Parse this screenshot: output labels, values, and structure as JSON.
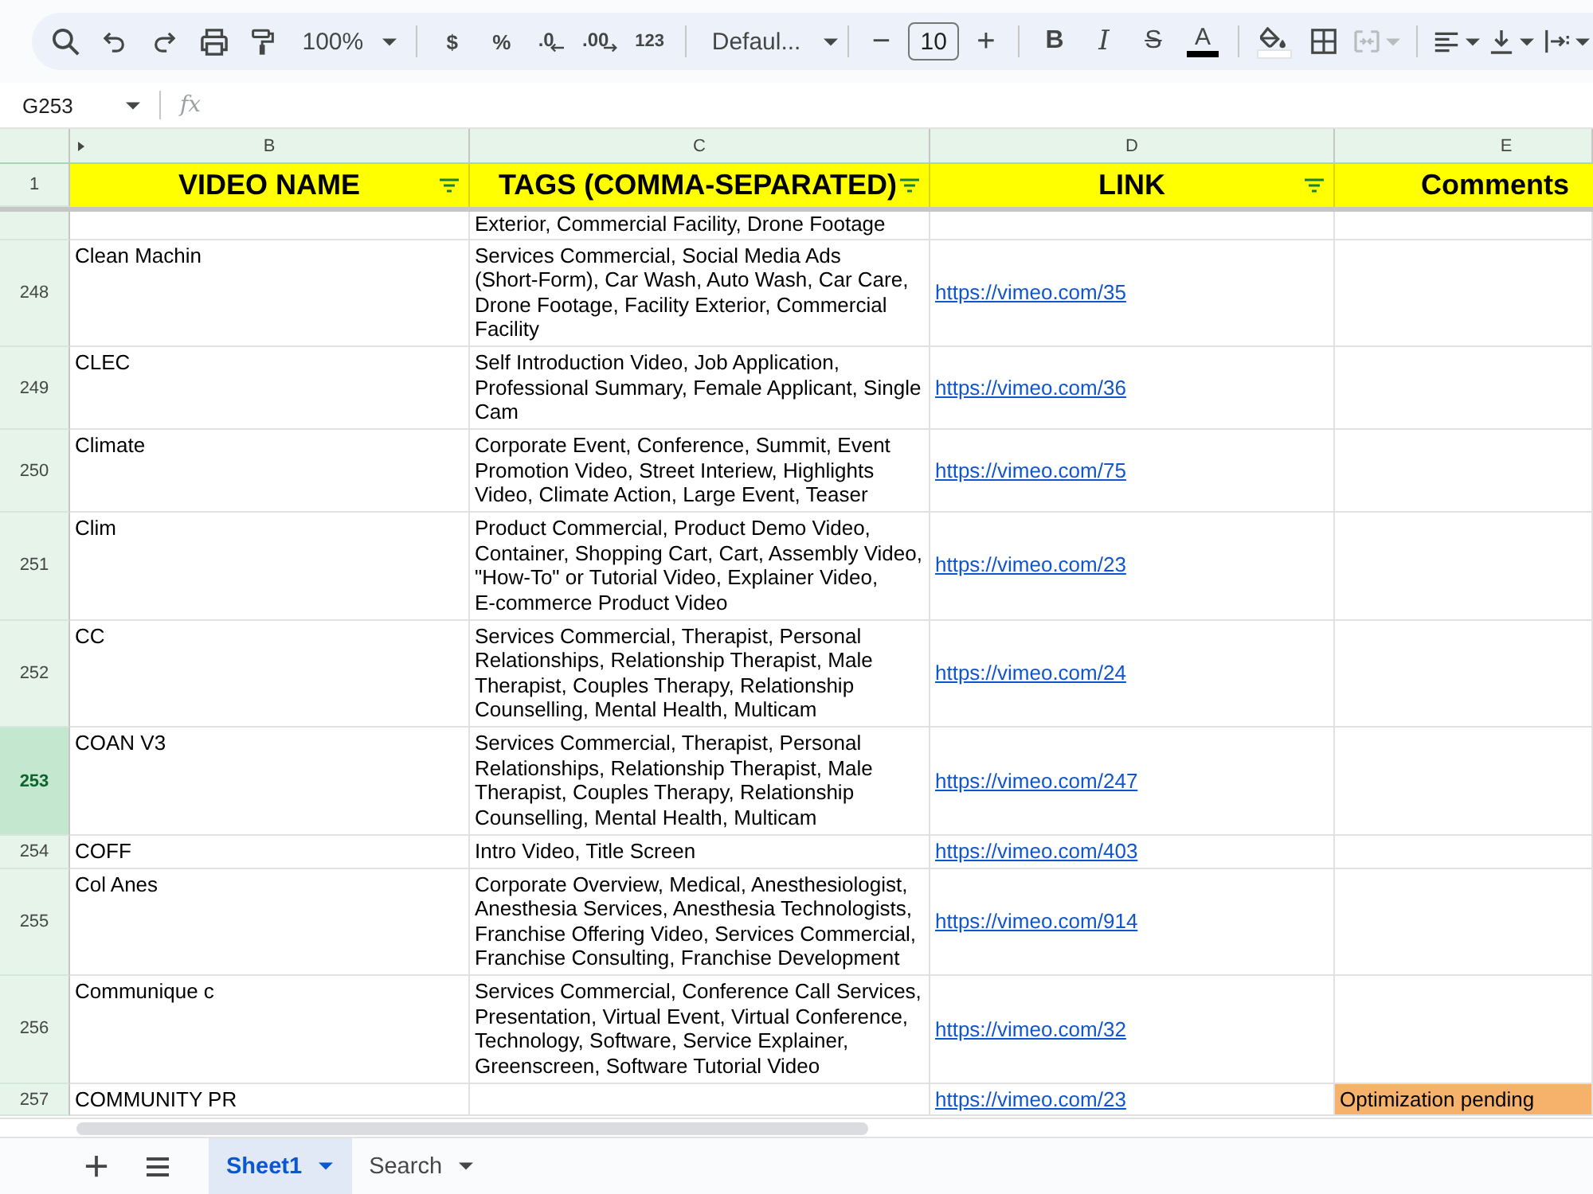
{
  "toolbar": {
    "groups": [
      [
        {
          "kind": "search"
        },
        {
          "kind": "undo"
        },
        {
          "kind": "redo"
        },
        {
          "kind": "print"
        },
        {
          "kind": "paint_format"
        },
        {
          "kind": "zoom",
          "label": "100%",
          "menu": true
        }
      ],
      [
        {
          "kind": "currency",
          "label": "$"
        },
        {
          "kind": "percent",
          "label": "%"
        },
        {
          "kind": "decimal_down",
          "label": ".0"
        },
        {
          "kind": "decimal_up",
          "label": ".00"
        },
        {
          "kind": "number_format",
          "label": "123"
        }
      ],
      [
        {
          "kind": "font",
          "label": "Defaul...",
          "menu": true
        }
      ],
      [
        {
          "kind": "size_down",
          "label": "−"
        },
        {
          "kind": "font_size",
          "value": "10"
        },
        {
          "kind": "size_up",
          "label": "+"
        }
      ],
      [
        {
          "kind": "bold",
          "label": "B"
        },
        {
          "kind": "italic",
          "label": "I"
        },
        {
          "kind": "strike",
          "label": "S"
        },
        {
          "kind": "text_color",
          "label": "A"
        }
      ],
      [
        {
          "kind": "fill_color"
        },
        {
          "kind": "borders"
        },
        {
          "kind": "merge",
          "menu": true,
          "disabled": true
        }
      ],
      [
        {
          "kind": "align",
          "menu": true
        },
        {
          "kind": "valign",
          "menu": true
        },
        {
          "kind": "wrap",
          "menu": true
        }
      ]
    ]
  },
  "formula_bar": {
    "cell_ref": "G253",
    "fx": "fx"
  },
  "sheet": {
    "columns": [
      {
        "letter": "B"
      },
      {
        "letter": "C"
      },
      {
        "letter": "D"
      },
      {
        "letter": "E"
      }
    ],
    "header_row": {
      "number": "1",
      "cells": [
        {
          "label": "VIDEO NAME",
          "filter": true
        },
        {
          "label": "TAGS (COMMA-SEPARATED)",
          "filter": true
        },
        {
          "label": "LINK",
          "filter": true
        },
        {
          "label": "Comments",
          "filter": false
        }
      ]
    },
    "rows": [
      {
        "selected": false,
        "tags": "Exterior, Commercial Facility, Drone Footage"
      },
      {
        "number": "248",
        "selected": false,
        "video_name": "Clean Machin",
        "tags": "Services Commercial, Social Media Ads (Short-Form), Car Wash, Auto Wash, Car Care, Drone Footage, Facility Exterior, Commercial Facility",
        "link": "https://vimeo.com/35"
      },
      {
        "number": "249",
        "selected": false,
        "video_name": "CLEC",
        "tags": "Self Introduction Video, Job Application, Professional Summary, Female Applicant, Single Cam",
        "link": "https://vimeo.com/36"
      },
      {
        "number": "250",
        "selected": false,
        "video_name": "Climate",
        "tags": "Corporate Event, Conference, Summit, Event Promotion Video, Street Interiew, Highlights Video, Climate Action, Large Event, Teaser",
        "link": "https://vimeo.com/75"
      },
      {
        "number": "251",
        "selected": false,
        "video_name": "Clim",
        "tags": "Product Commercial, Product Demo Video, Container, Shopping Cart, Cart, Assembly Video, \"How-To\" or Tutorial Video, Explainer Video, E-commerce Product Video",
        "link": "https://vimeo.com/23"
      },
      {
        "number": "252",
        "selected": false,
        "video_name": "CC",
        "tags": "Services Commercial, Therapist, Personal Relationships, Relationship Therapist, Male Therapist, Couples Therapy, Relationship Counselling, Mental Health, Multicam",
        "link": "https://vimeo.com/24"
      },
      {
        "number": "253",
        "selected": true,
        "video_name": "COAN V3",
        "tags": "Services Commercial, Therapist, Personal Relationships, Relationship Therapist, Male Therapist, Couples Therapy, Relationship Counselling, Mental Health, Multicam",
        "link": "https://vimeo.com/247"
      },
      {
        "number": "254",
        "selected": false,
        "video_name": "COFF",
        "tags": "Intro Video, Title Screen",
        "link": "https://vimeo.com/403"
      },
      {
        "number": "255",
        "selected": false,
        "video_name": "Col Anes",
        "tags": "Corporate Overview, Medical, Anesthesiologist, Anesthesia Services, Anesthesia Technologists, Franchise Offering Video, Services Commercial, Franchise Consulting, Franchise Development",
        "link": "https://vimeo.com/914"
      },
      {
        "number": "256",
        "selected": false,
        "video_name": "Communique c",
        "tags": "Services Commercial, Conference Call Services, Presentation, Virtual Event, Virtual Conference, Technology, Software, Service Explainer, Greenscreen, Software Tutorial Video",
        "link": "https://vimeo.com/32"
      },
      {
        "number": "257",
        "selected": false,
        "video_name": "COMMUNITY PR",
        "link": "https://vimeo.com/23",
        "comment": {
          "text": "Optimization pending",
          "color": "#f6b26b"
        }
      }
    ]
  },
  "sheet_tabs": [
    {
      "label": "Sheet1",
      "selected": true
    },
    {
      "label": "Search",
      "selected": false
    }
  ]
}
